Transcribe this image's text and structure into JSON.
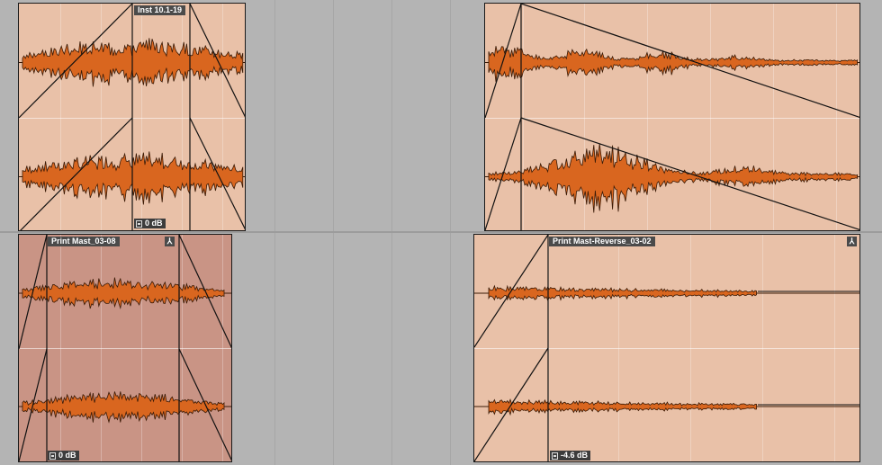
{
  "colors": {
    "background": "#b4b4b4",
    "clip_light": "#e9c1a8",
    "clip_selected": "#c99485",
    "waveform_fill": "#d9661f",
    "waveform_outline": "#3a1a06"
  },
  "clips": [
    {
      "id": "clip1",
      "name": "Inst 10.1-19",
      "gain": "0 dB",
      "selected": false,
      "sync_icon": false
    },
    {
      "id": "clip2",
      "name": "",
      "gain": "",
      "selected": false,
      "sync_icon": false
    },
    {
      "id": "clip3",
      "name": "Print Mast_03-08",
      "gain": "0 dB",
      "selected": true,
      "sync_icon": true
    },
    {
      "id": "clip4",
      "name": "Print Mast-Reverse_03-02",
      "gain": "-4.6 dB",
      "selected": false,
      "sync_icon": true
    }
  ],
  "icons": {
    "gain": "clip-gain-icon",
    "sync": "sync-point-icon"
  }
}
